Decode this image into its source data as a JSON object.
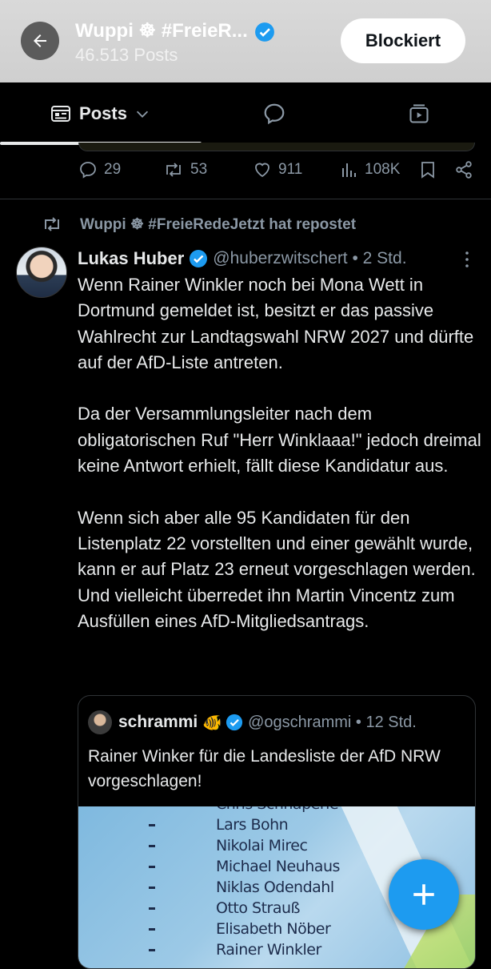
{
  "header": {
    "profile_name": "Wuppi ☸ #FreieR...",
    "posts_count": "46.513 Posts",
    "blocked_label": "Blockiert"
  },
  "tabs": [
    {
      "label": "Posts"
    },
    {
      "icon": "replies-icon"
    },
    {
      "icon": "media-icon"
    }
  ],
  "previous_post_actions": {
    "replies": "29",
    "reposts": "53",
    "likes": "911",
    "views": "108K"
  },
  "repost_notice": "Wuppi ☸ #FreieRedeJetzt hat repostet",
  "tweet": {
    "author_name": "Lukas Huber",
    "handle_time": "@huberzwitschert • 2 Std.",
    "paragraphs": [
      "Wenn Rainer Winkler noch bei Mona Wett in Dortmund gemeldet ist, besitzt er das passive Wahlrecht zur Landtagswahl NRW 2027 und dürfte auf der AfD-Liste antreten.",
      "Da der Versammlungsleiter nach dem obligatorischen Ruf \"Herr Winklaaa!\" jedoch dreimal keine Antwort erhielt, fällt diese Kandidatur aus.",
      "Wenn sich aber alle 95 Kandidaten für den Listenplatz 22 vorstellten und einer gewählt wurde, kann er auf Platz 23 erneut vorgeschlagen werden. Und vielleicht überredet ihn Martin Vincentz zum Ausfüllen eines AfD-Mitgliedsantrags."
    ]
  },
  "quote": {
    "author_name": "schrammi",
    "emoji": "🐠",
    "handle_time": "@ogschrammi • 12 Std.",
    "text": "Rainer Winker für die Landesliste der AfD NRW vorgeschlagen!",
    "image_names": [
      "Chris Schnaperle",
      "Lars Bohn",
      "Nikolai Mirec",
      "Michael Neuhaus",
      "Niklas Odendahl",
      "Otto Strauß",
      "Elisabeth Nöber",
      "Rainer Winkler"
    ]
  },
  "colors": {
    "accent": "#1d9bf0",
    "background": "#000000",
    "secondary_text": "#8b98a5"
  }
}
